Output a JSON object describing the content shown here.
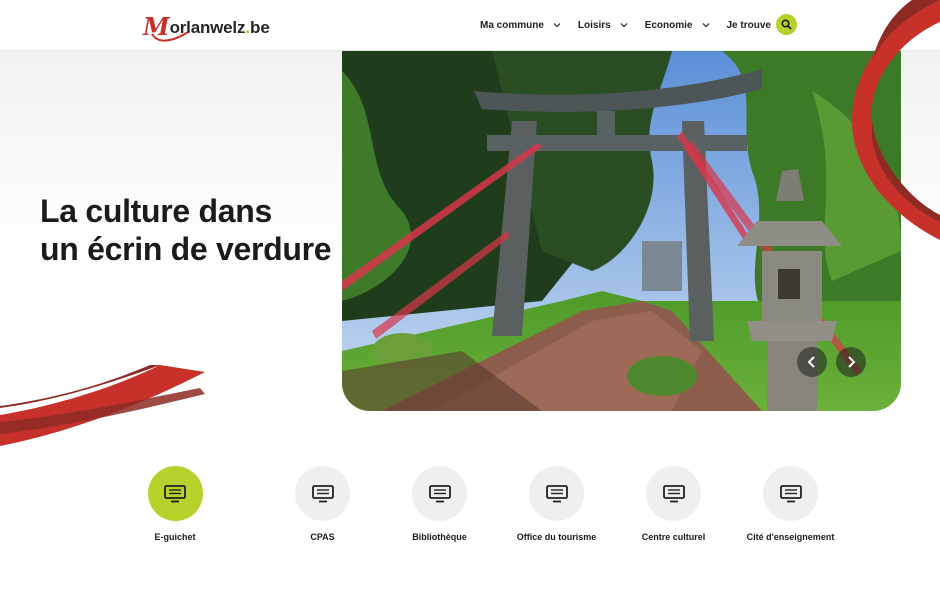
{
  "site": {
    "logo_m": "M",
    "logo_rest": "orlanwelz",
    "logo_dot": ".",
    "logo_tld": "be"
  },
  "nav": {
    "items": [
      {
        "label": "Ma commune"
      },
      {
        "label": "Loisirs"
      },
      {
        "label": "Economie"
      },
      {
        "label": "Je trouve"
      }
    ],
    "search_icon": "search-icon"
  },
  "hero": {
    "line1_pre": "La ",
    "line1_bold": "culture",
    "line1_post": " dans",
    "line2_pre": "un écrin de ",
    "line2_bold": "verdure",
    "image_subject": "japanese-garden-torii-gate",
    "prev_icon": "chevron-left-icon",
    "next_icon": "chevron-right-icon"
  },
  "quicklinks": [
    {
      "label": "E-guichet",
      "icon": "monitor-icon",
      "active": true
    },
    {
      "label": "CPAS",
      "icon": "monitor-icon",
      "active": false
    },
    {
      "label": "Bibliothèque",
      "icon": "monitor-icon",
      "active": false
    },
    {
      "label": "Office du tourisme",
      "icon": "monitor-icon",
      "active": false
    },
    {
      "label": "Centre culturel",
      "icon": "monitor-icon",
      "active": false
    },
    {
      "label": "Cité d'enseignement",
      "icon": "monitor-icon",
      "active": false
    }
  ],
  "colors": {
    "accent_green": "#b6d12b",
    "brand_red": "#c8312a",
    "dark_red": "#8e2a24"
  }
}
